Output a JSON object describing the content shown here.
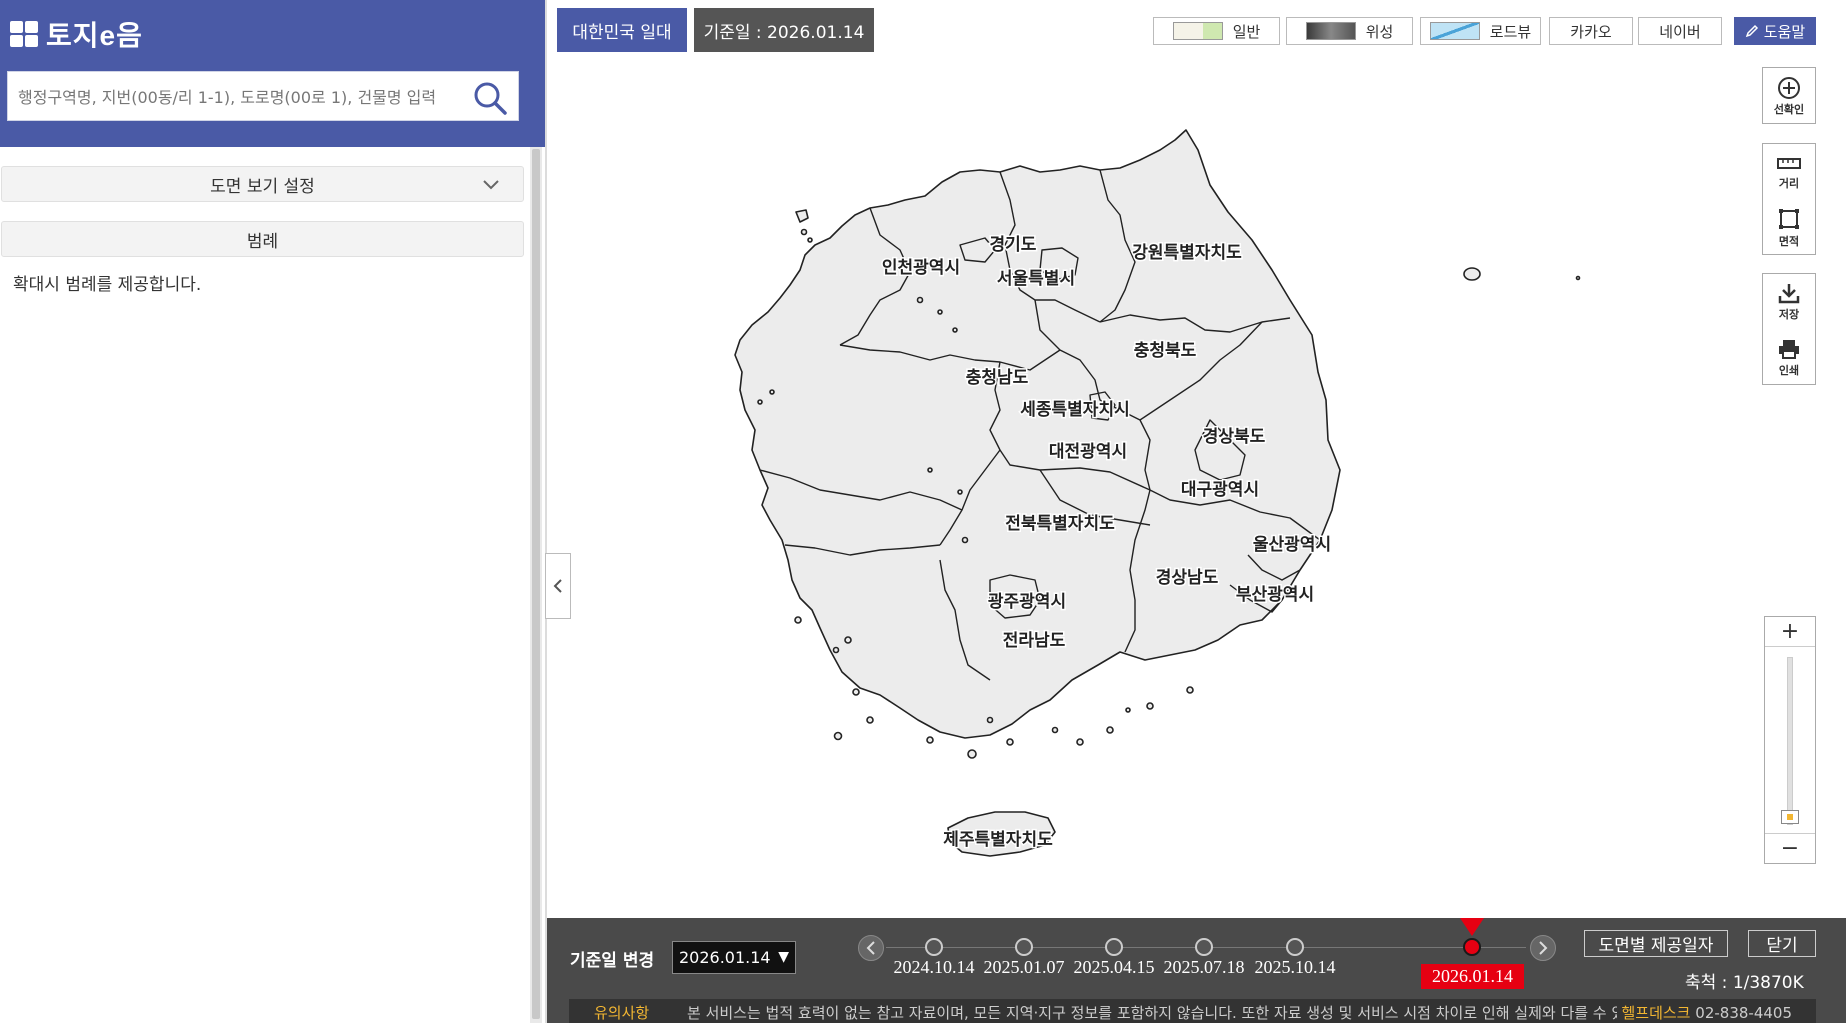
{
  "app": {
    "logo_text": "토지e음"
  },
  "search": {
    "placeholder": "행정구역명, 지번(00동/리 1-1), 도로명(00로 1), 건물명 입력"
  },
  "left_panel": {
    "view_settings_label": "도면 보기 설정",
    "legend_label": "범례",
    "legend_message": "확대시 범례를 제공합니다."
  },
  "map_header": {
    "region_button": "대한민국 일대",
    "base_date_label": "기준일 : 2026.01.14"
  },
  "map_types": {
    "basic": "일반",
    "satellite": "위성",
    "roadview": "로드뷰",
    "kakao": "카카오",
    "naver": "네이버",
    "help": "도움말"
  },
  "tools": {
    "line_check": "선확인",
    "distance": "거리",
    "area": "면적",
    "save": "저장",
    "print": "인쇄"
  },
  "zoom": {
    "in": "+",
    "out": "−",
    "level_fraction": 0.1
  },
  "regions": [
    {
      "name": "경기도"
    },
    {
      "name": "인천광역시"
    },
    {
      "name": "서울특별시"
    },
    {
      "name": "강원특별자치도"
    },
    {
      "name": "충청북도"
    },
    {
      "name": "충청남도"
    },
    {
      "name": "세종특별자치시"
    },
    {
      "name": "대전광역시"
    },
    {
      "name": "경상북도"
    },
    {
      "name": "대구광역시"
    },
    {
      "name": "전북특별자치도"
    },
    {
      "name": "울산광역시"
    },
    {
      "name": "경상남도"
    },
    {
      "name": "부산광역시"
    },
    {
      "name": "광주광역시"
    },
    {
      "name": "전라남도"
    },
    {
      "name": "제주특별자치도"
    }
  ],
  "timeline": {
    "change_label": "기준일 변경",
    "selected": "2026.01.14",
    "dates": [
      "2024.10.14",
      "2025.01.07",
      "2025.04.15",
      "2025.07.18",
      "2025.10.14"
    ],
    "active_date": "2026.01.14",
    "provide_button": "도면별 제공일자",
    "close_button": "닫기",
    "scale": "축척 : 1/3870K"
  },
  "notice": {
    "title": "유의사항",
    "text": "본 서비스는 법적 효력이 없는 참고 자료이며, 모든 지역·지구 정보를 포함하지 않습니다. 또한 자료 생성 및 서비스 시점 차이로 인해 실제와 다를 수 있습니다.",
    "helpdesk_label": "헬프데스크",
    "helpdesk_number": "02-838-4405"
  },
  "colors": {
    "brand": "#4a5aa6",
    "active_red": "#e60012",
    "bottom_bar": "#4a4a4a",
    "land_fill": "#ececec"
  }
}
